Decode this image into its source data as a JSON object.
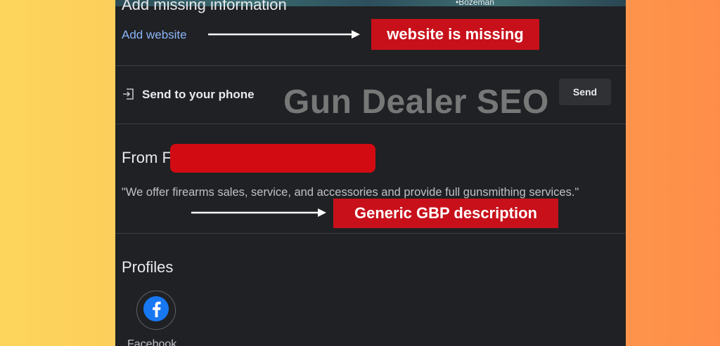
{
  "map": {
    "place_label": "•Bozeman"
  },
  "missing_info": {
    "heading": "Add missing information",
    "link_label": "Add website"
  },
  "send_to_phone": {
    "label": "Send to your phone",
    "button_label": "Send"
  },
  "from_section": {
    "title_prefix": "From F",
    "description": "\"We offer firearms sales, service, and accessories and provide full gunsmithing services.\""
  },
  "profiles": {
    "title": "Profiles",
    "items": [
      {
        "label": "Facebook",
        "icon": "facebook-icon"
      }
    ]
  },
  "annotations": {
    "callout_website": "website is missing",
    "callout_description": "Generic GBP description",
    "watermark": "Gun Dealer SEO"
  },
  "colors": {
    "panel_bg": "#202124",
    "link": "#8ab4f8",
    "callout_red": "#c8101a",
    "redaction_red": "#d20b12",
    "facebook_blue": "#1877f2"
  }
}
